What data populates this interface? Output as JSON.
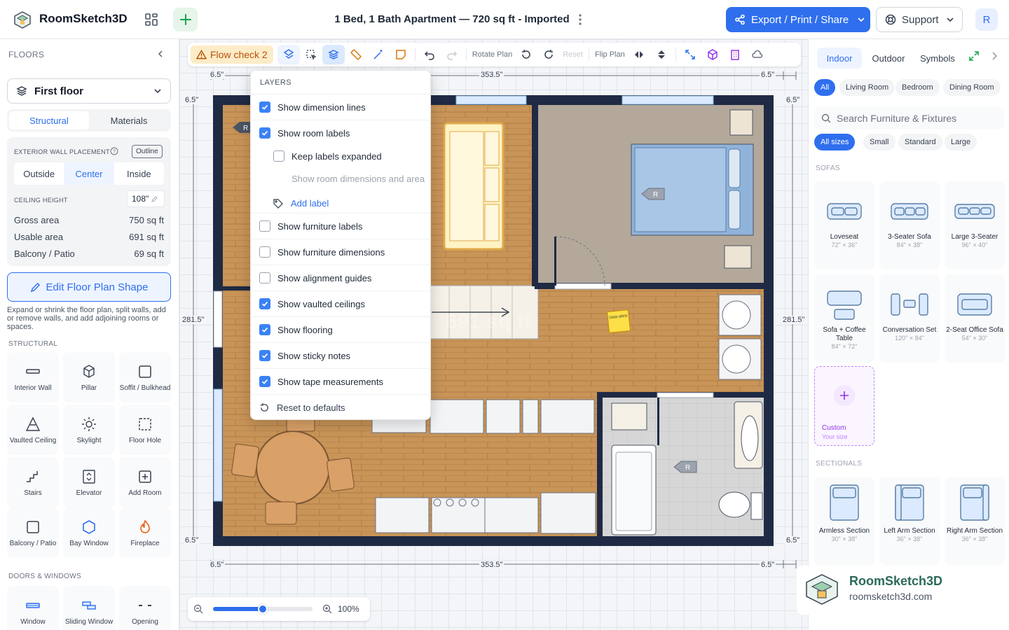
{
  "header": {
    "app_name": "RoomSketch3D",
    "doc_title": "1 Bed, 1 Bath Apartment — 720 sq ft - Imported",
    "export_label": "Export / Print / Share",
    "support_label": "Support",
    "avatar_initial": "R"
  },
  "left": {
    "floors_title": "FLOORS",
    "floor_selected": "First floor",
    "tabs": [
      "Structural",
      "Materials"
    ],
    "wall_placement_label": "EXTERIOR WALL PLACEMENT",
    "outline_badge": "Outline",
    "wall_options": [
      "Outside",
      "Center",
      "Inside"
    ],
    "ceiling_label": "CEILING HEIGHT",
    "ceiling_value": "108\"",
    "gross_label": "Gross area",
    "gross_value": "750 sq ft",
    "usable_label": "Usable area",
    "usable_value": "691 sq ft",
    "balcony_label": "Balcony / Patio",
    "balcony_value": "69 sq ft",
    "edit_label": "Edit Floor Plan Shape",
    "hint": "Expand or shrink the floor plan, split walls, add or remove walls, and add adjoining rooms or spaces.",
    "structural_title": "STRUCTURAL",
    "structural_tiles": [
      "Interior Wall",
      "Pillar",
      "Soffit / Bulkhead",
      "Vaulted Ceiling",
      "Skylight",
      "Floor Hole",
      "Stairs",
      "Elevator",
      "Add Room",
      "Balcony / Patio",
      "Bay Window",
      "Fireplace"
    ],
    "doors_title": "DOORS & WINDOWS",
    "door_tiles": [
      "Window",
      "Sliding Window",
      "Opening"
    ]
  },
  "toolbar": {
    "flow_check": "Flow check 2",
    "rotate": "Rotate Plan",
    "reset": "Reset",
    "flip": "Flip Plan"
  },
  "dims": {
    "top_left": "6.5\"",
    "top_mid": "353.5\"",
    "top_right": "6.5\"",
    "left_top": "6.5\"",
    "left_mid": "281.5\"",
    "left_bot": "6.5\"",
    "right_top": "6.5\"",
    "right_mid": "281.5\"",
    "right_bot": "6.5\"",
    "bot_left": "6.5\"",
    "bot_mid": "353.5\"",
    "bot_right": "6.5\""
  },
  "plan": {
    "area_watermark": "691 sq ft",
    "sticky_note": "Contractor: confirm the",
    "room_marker": "R"
  },
  "layers": {
    "title": "LAYERS",
    "items": [
      {
        "label": "Show dimension lines",
        "state": "on",
        "indent": false
      },
      {
        "label": "Show room labels",
        "state": "on",
        "indent": false
      },
      {
        "label": "Keep labels expanded",
        "state": "off",
        "indent": true
      },
      {
        "label": "Show room dimensions and area",
        "state": "disabled",
        "indent": true
      },
      {
        "label": "Show furniture labels",
        "state": "off",
        "indent": false
      },
      {
        "label": "Show furniture dimensions",
        "state": "off",
        "indent": false
      },
      {
        "label": "Show alignment guides",
        "state": "off",
        "indent": false
      },
      {
        "label": "Show vaulted ceilings",
        "state": "on",
        "indent": false
      },
      {
        "label": "Show flooring",
        "state": "on",
        "indent": false
      },
      {
        "label": "Show sticky notes",
        "state": "on",
        "indent": false
      },
      {
        "label": "Show tape measurements",
        "state": "on",
        "indent": false
      }
    ],
    "add_label": "Add label",
    "reset_label": "Reset to defaults"
  },
  "zoom": {
    "value": 0.5,
    "label": "100%"
  },
  "right": {
    "tabs": [
      "Indoor",
      "Outdoor",
      "Symbols"
    ],
    "room_chips": [
      "All",
      "Living Room",
      "Bedroom",
      "Dining Room"
    ],
    "search_placeholder": "Search Furniture & Fixtures",
    "size_chips": [
      "All sizes",
      "Small",
      "Standard",
      "Large"
    ],
    "sofas_title": "SOFAS",
    "sofas": [
      {
        "name": "Loveseat",
        "size": "72\" × 36\""
      },
      {
        "name": "3-Seater Sofa",
        "size": "84\" × 38\""
      },
      {
        "name": "Large 3-Seater",
        "size": "96\" × 40\""
      },
      {
        "name": "Sofa + Coffee Table",
        "size": "84\" × 72\""
      },
      {
        "name": "Conversation Set",
        "size": "120\" × 84\""
      },
      {
        "name": "2-Seat Office Sofa",
        "size": "54\" × 30\""
      }
    ],
    "custom_label": "Custom",
    "custom_sub": "Your size",
    "sectionals_title": "SECTIONALS",
    "sectionals": [
      {
        "name": "Armless Section",
        "size": "30\" × 38\""
      },
      {
        "name": "Left Arm Section",
        "size": "36\" × 38\""
      },
      {
        "name": "Right Arm Section",
        "size": "36\" × 38\""
      }
    ],
    "watermark_name": "RoomSketch3D",
    "watermark_url": "roomsketch3d.com"
  },
  "colors": {
    "accent": "#2f6fed",
    "wall": "#1f2a44",
    "wood": "#c89458",
    "bath_tile": "#d6d6d6",
    "bedroom_floor": "#b3a89a"
  }
}
